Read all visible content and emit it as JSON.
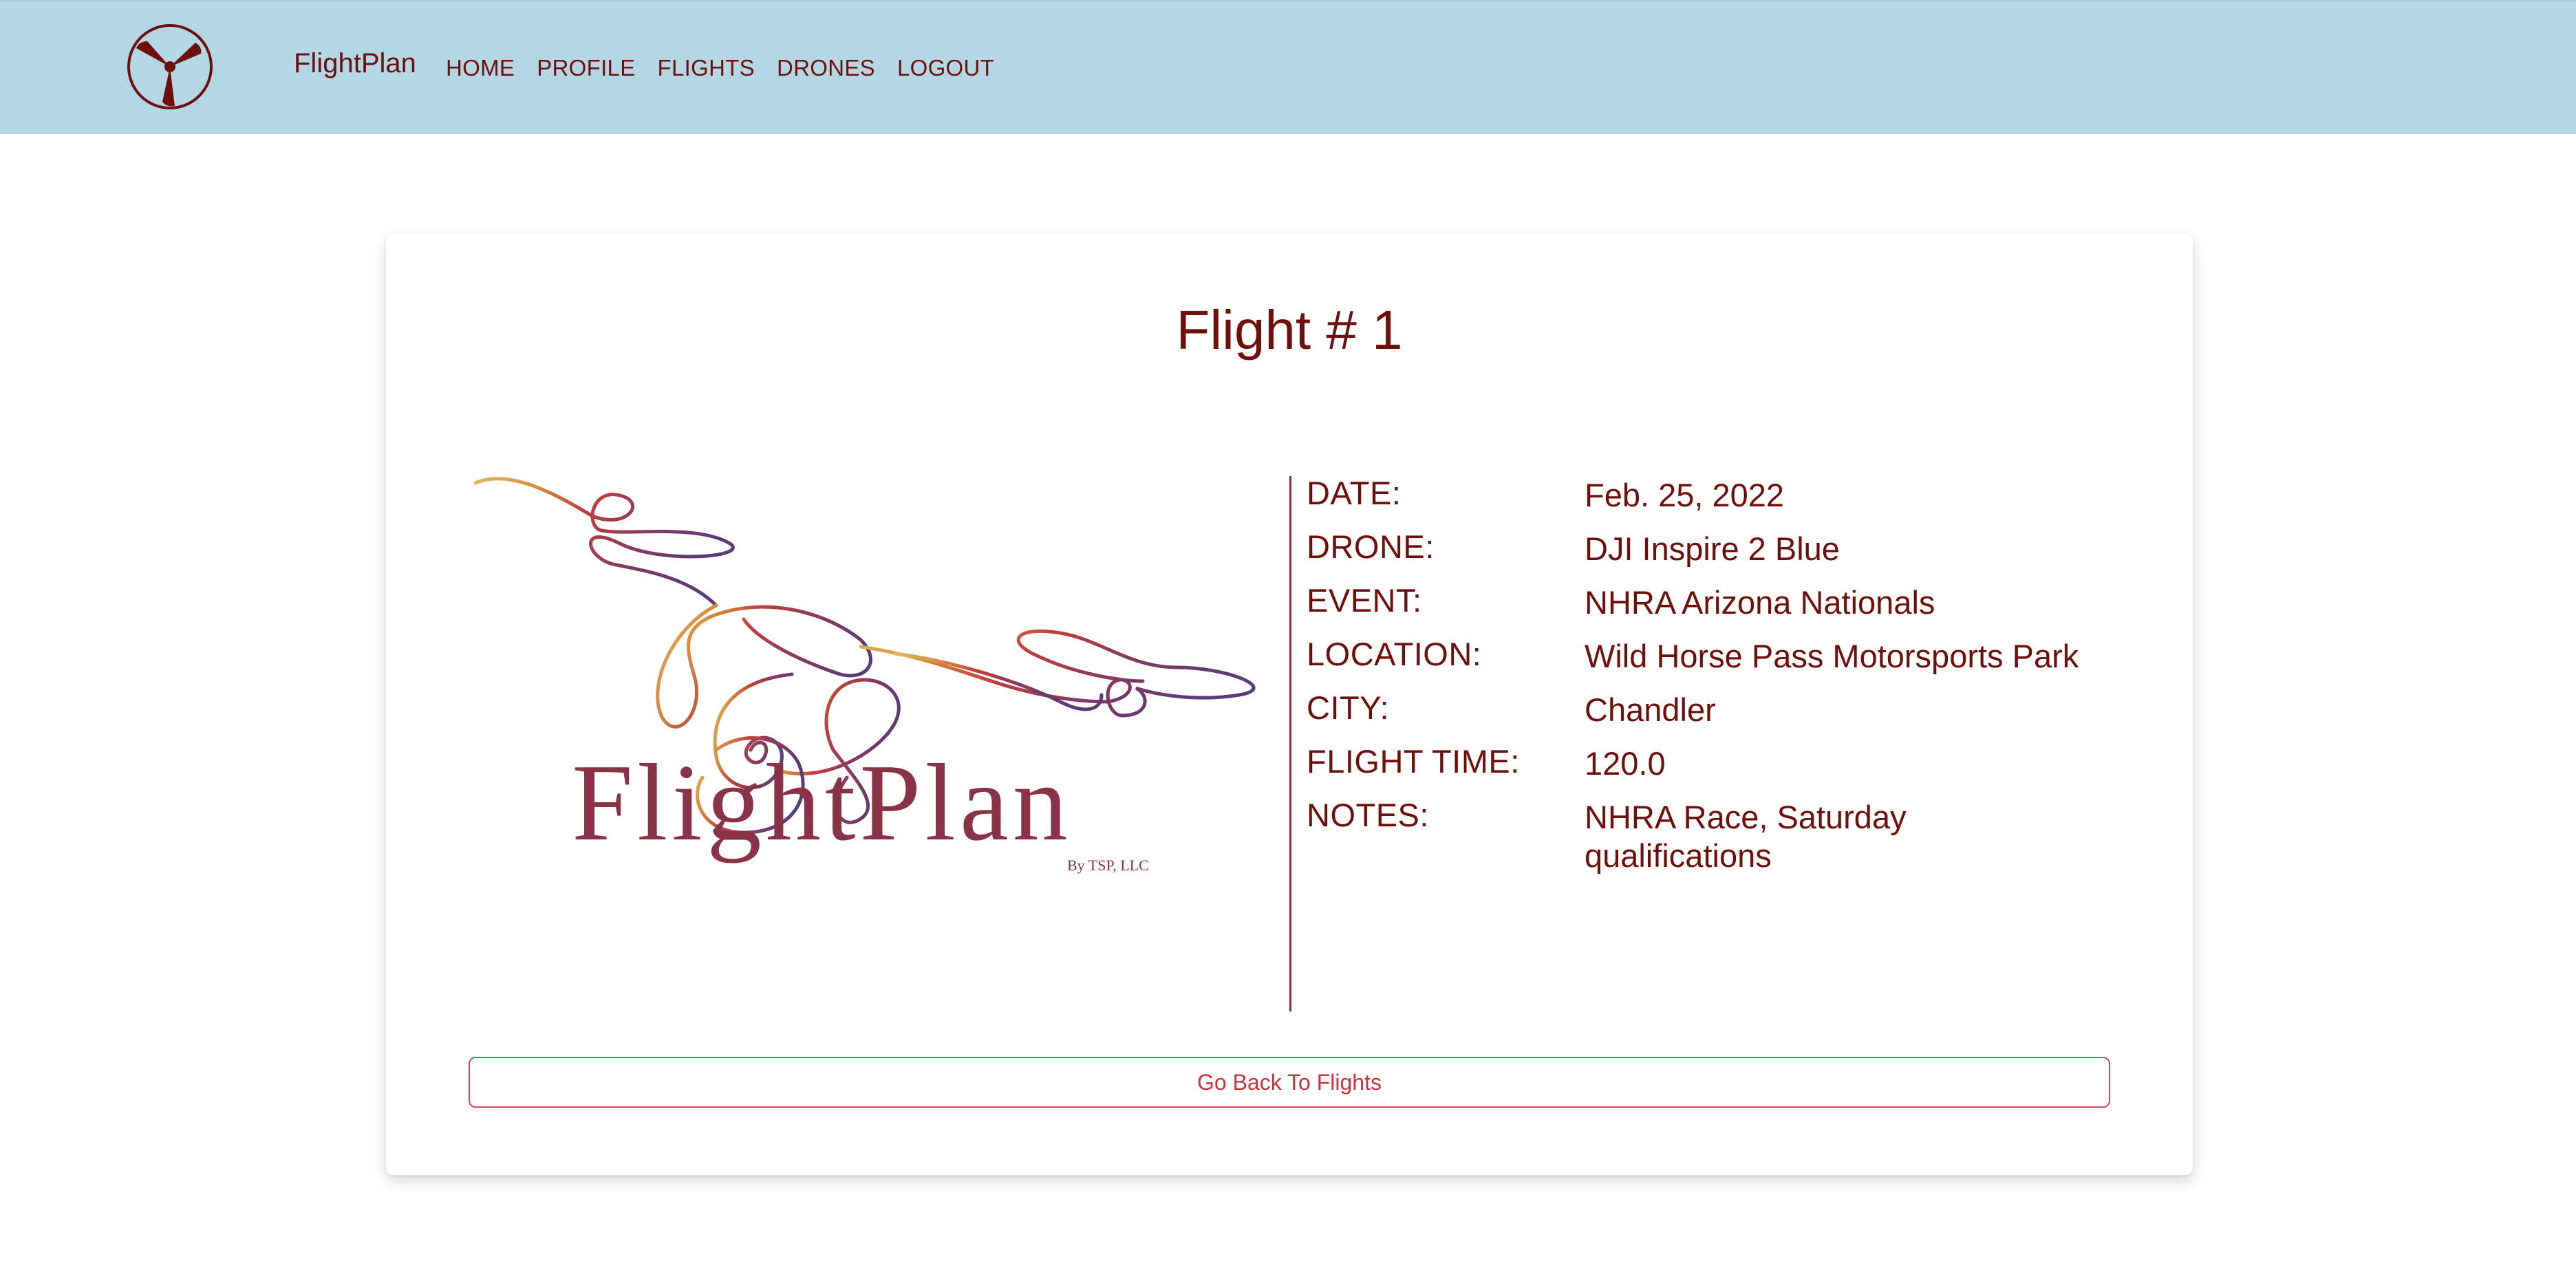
{
  "nav": {
    "brand": "FlightPlan",
    "links": [
      "HOME",
      "PROFILE",
      "FLIGHTS",
      "DRONES",
      "LOGOUT"
    ]
  },
  "flight": {
    "title": "Flight # 1",
    "details": [
      {
        "label": "DATE:",
        "value": "Feb. 25, 2022"
      },
      {
        "label": "DRONE:",
        "value": "DJI Inspire 2 Blue"
      },
      {
        "label": "EVENT:",
        "value": "NHRA Arizona Nationals"
      },
      {
        "label": "LOCATION:",
        "value": "Wild Horse Pass Motorsports Park"
      },
      {
        "label": "CITY:",
        "value": "Chandler"
      },
      {
        "label": "FLIGHT TIME:",
        "value": "120.0"
      },
      {
        "label": "NOTES:",
        "value": "NHRA Race, Saturday qualifications"
      }
    ]
  },
  "logo": {
    "wordmark": "FlightPlan",
    "byline": "By TSP, LLC"
  },
  "back_button": "Go Back To Flights",
  "colors": {
    "navbar": "#b3d7e5",
    "text": "#6e0f0b",
    "accent": "#c8323f"
  }
}
